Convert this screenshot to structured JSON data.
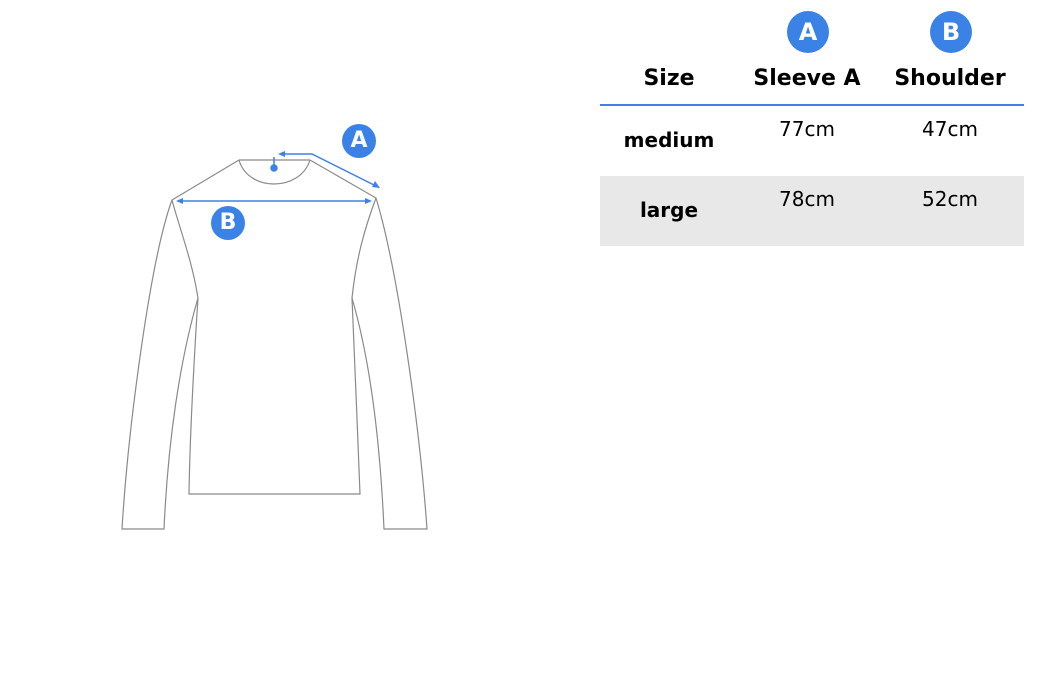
{
  "colors": {
    "accent": "#3b82e6",
    "row_alt_bg": "#e8e8e8",
    "outline": "#8a8a8a"
  },
  "diagram": {
    "marker_a": "A",
    "marker_b": "B"
  },
  "table": {
    "badges": {
      "a": "A",
      "b": "B"
    },
    "headers": [
      "Size",
      "Sleeve A",
      "Shoulder"
    ],
    "rows": [
      {
        "size": "medium",
        "sleeve": "77cm",
        "shoulder": "47cm"
      },
      {
        "size": "large",
        "sleeve": "78cm",
        "shoulder": "52cm"
      }
    ]
  }
}
